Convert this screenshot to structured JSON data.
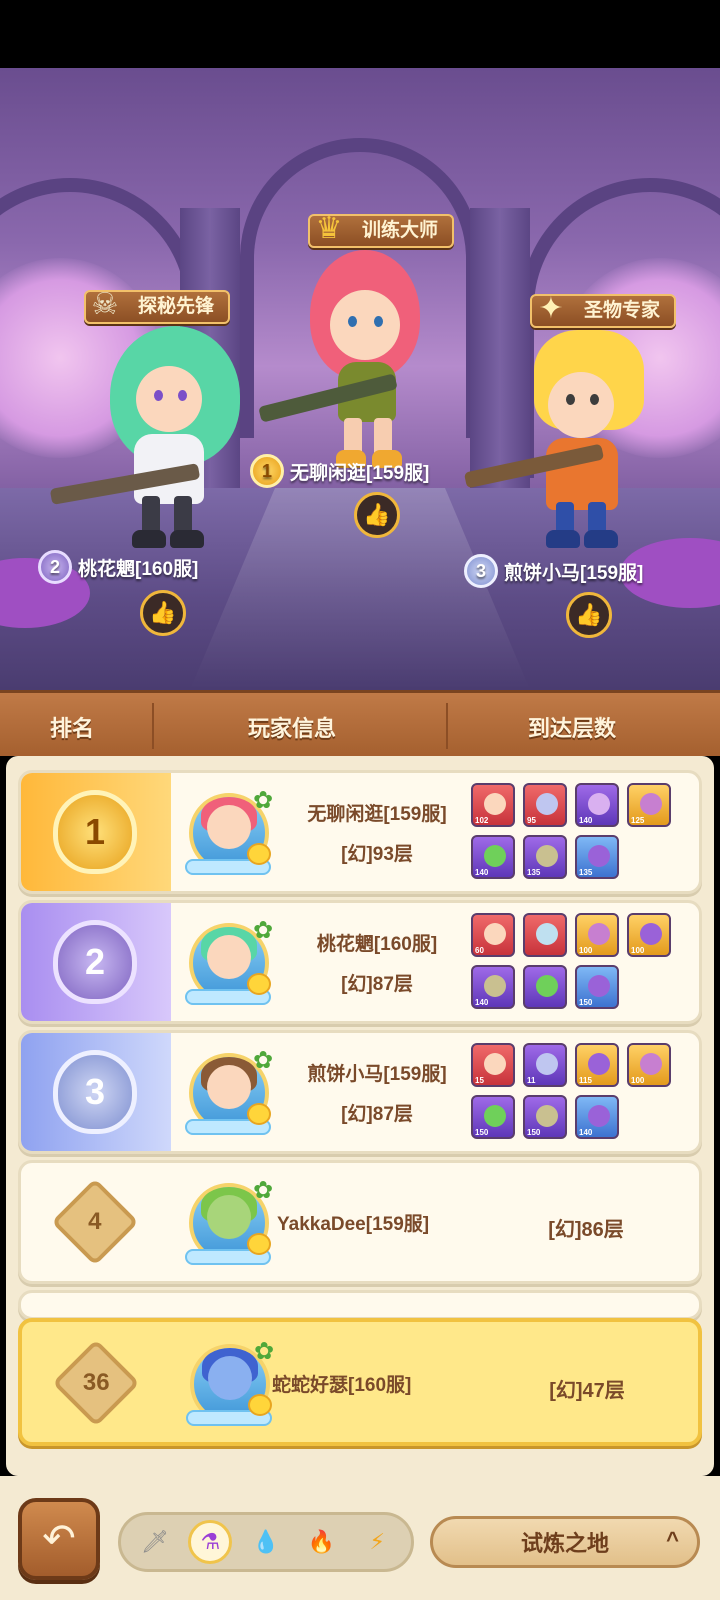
{
  "podium": {
    "first": {
      "title": "训练大师",
      "rank": "1",
      "name": "无聊闲逛[159服]"
    },
    "second": {
      "title": "探秘先锋",
      "rank": "2",
      "name": "桃花魍[160服]"
    },
    "third": {
      "title": "圣物专家",
      "rank": "3",
      "name": "煎饼小马[159服]"
    }
  },
  "table_header": {
    "rank": "排名",
    "player": "玩家信息",
    "floor": "到达层数"
  },
  "rows": [
    {
      "rank": "1",
      "name": "无聊闲逛[159服]",
      "floor": "[幻]93层",
      "chars": [
        "102",
        "95",
        "140",
        "125",
        "140",
        "135",
        "135"
      ]
    },
    {
      "rank": "2",
      "name": "桃花魍[160服]",
      "floor": "[幻]87层",
      "chars": [
        "60",
        "",
        "100",
        "100",
        "140",
        "",
        "150"
      ]
    },
    {
      "rank": "3",
      "name": "煎饼小马[159服]",
      "floor": "[幻]87层",
      "chars": [
        "15",
        "11",
        "115",
        "100",
        "150",
        "150",
        "140"
      ]
    },
    {
      "rank": "4",
      "name": "YakkaDee[159服]",
      "floor": "[幻]86层"
    }
  ],
  "self_row": {
    "rank": "36",
    "name": "蛇蛇好瑟[160服]",
    "floor": "[幻]47层"
  },
  "bottom": {
    "back_icon": "↶",
    "mode_label": "试炼之地",
    "mode_chevron": "^",
    "elements": [
      "sword-icon",
      "potion-icon",
      "water-drop-icon",
      "fire-icon",
      "lightning-icon"
    ]
  },
  "colors": {
    "gold": "#f2b233",
    "silver_purple": "#8f74d6",
    "bronze_blue": "#7e8fe0",
    "wood": "#a5602f",
    "panel": "#f4ead2",
    "self_highlight": "#ffe88a"
  }
}
